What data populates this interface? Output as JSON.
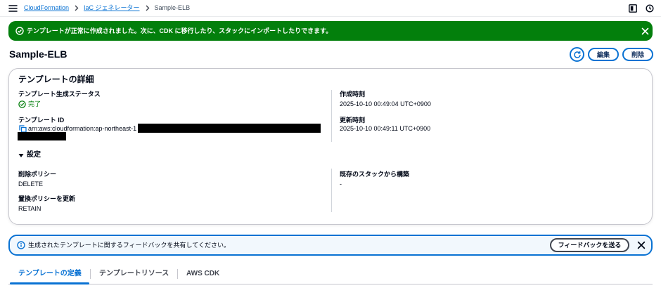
{
  "colors": {
    "link": "#0972d3",
    "success": "#037f0c",
    "text": "#000716",
    "info_background": "#f2f8fd",
    "redaction": "#000000"
  },
  "topbar": {
    "menu_icon": "menu-icon",
    "breadcrumb": [
      {
        "label": "CloudFormation",
        "link": true
      },
      {
        "label": "IaC ジェネレーター",
        "link": true
      },
      {
        "label": "Sample-ELB",
        "link": false
      }
    ],
    "separator_icon": "chevron-right-icon",
    "tool_icons": [
      "split-panel-icon",
      "clock-icon"
    ]
  },
  "flash": {
    "type": "success",
    "icon": "status-success-icon",
    "message": "テンプレートが正常に作成されました。次に、CDK に移行したり、スタックにインポートしたりできます。",
    "close_icon": "close-icon"
  },
  "header": {
    "title": "Sample-ELB",
    "refresh_icon": "refresh-icon",
    "edit_label": "編集",
    "delete_label": "削除"
  },
  "details": {
    "title": "テンプレートの詳細",
    "status_label": "テンプレート生成ステータス",
    "status_value": "完了",
    "status_icon": "status-success-icon",
    "template_id_label": "テンプレート ID",
    "template_id_value": "arn:aws:cloudformation:ap-northeast-1",
    "copy_icon": "copy-icon",
    "created_label": "作成時刻",
    "created_value": "2025-10-10 00:49:04 UTC+0900",
    "updated_label": "更新時刻",
    "updated_value": "2025-10-10 00:49:11 UTC+0900",
    "settings": {
      "toggle_label": "設定",
      "expanded": true,
      "toggle_icon": "caret-down-icon",
      "deletion_policy_label": "削除ポリシー",
      "deletion_policy_value": "DELETE",
      "update_replace_policy_label": "置換ポリシーを更新",
      "update_replace_policy_value": "RETAIN",
      "from_existing_stack_label": "既存のスタックから構築",
      "from_existing_stack_value": "-"
    }
  },
  "feedback": {
    "icon": "info-icon",
    "message": "生成されたテンプレートに関するフィードバックを共有してください。",
    "button_label": "フィードバックを送る",
    "close_icon": "close-icon"
  },
  "tabs": [
    {
      "label": "テンプレートの定義",
      "active": true
    },
    {
      "label": "テンプレートリソース",
      "active": false
    },
    {
      "label": "AWS CDK",
      "active": false
    }
  ]
}
